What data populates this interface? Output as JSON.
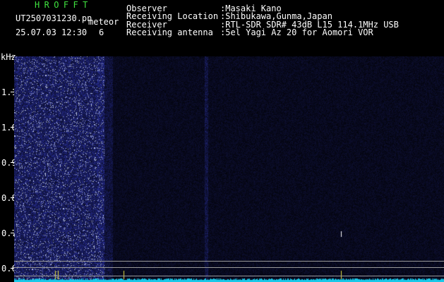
{
  "header": {
    "app_title": "HROFFT",
    "filename": "UT2507031230.pn",
    "tag": "meteor",
    "datetime": "25.07.03 12:30",
    "count": "6",
    "info": [
      {
        "label": "Observer",
        "value": ":Masaki Kano"
      },
      {
        "label": "Receiving Location",
        "value": ":Shibukawa,Gunma,Japan"
      },
      {
        "label": "Receiver",
        "value": ":RTL-SDR SDR# 43dB L15 114.1MHz USB"
      },
      {
        "label": "Receiving antenna",
        "value": ":5el Yagi Az 20 for Aomori VOR"
      }
    ]
  },
  "axes": {
    "x_ticks": [
      "123",
      "123",
      "123",
      "123",
      "123",
      "123",
      "123",
      "123",
      "123",
      "1240"
    ],
    "y_unit": "kHz",
    "y_ticks": [
      "1.1",
      "1.0",
      "0.9",
      "0.8",
      "0.7",
      "0.6"
    ]
  },
  "colors": {
    "background": "#000000",
    "title": "#3fe23f",
    "signal_baseline": "#19c8e8",
    "noise": "#1a2bd0",
    "marker_line": "#9a9a9a",
    "spike": "#e8e040"
  }
}
